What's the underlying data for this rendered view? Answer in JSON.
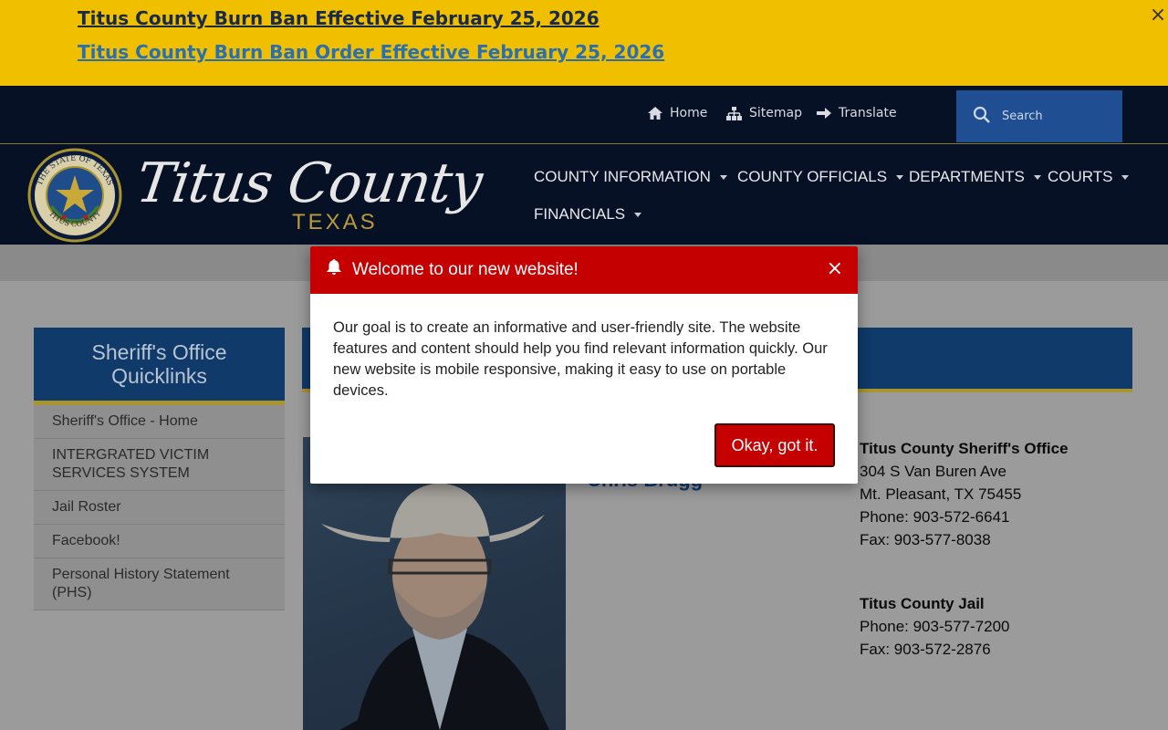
{
  "alerts": {
    "items": [
      "Titus County Burn Ban Effective February 25, 2026",
      "Titus County Burn Ban Order Effective February 25, 2026"
    ],
    "close_glyph": "×"
  },
  "utility_nav": {
    "home": "Home",
    "sitemap": "Sitemap",
    "translate": "Translate",
    "search_placeholder": "Search"
  },
  "brand": {
    "name": "Titus County",
    "sub": "TEXAS",
    "seal_top_text": "THE STATE OF TEXAS",
    "seal_bottom_text": "TITUS COUNTY",
    "accent": "#a8952e",
    "navy": "#071126"
  },
  "main_nav": [
    "COUNTY INFORMATION",
    "COUNTY OFFICIALS",
    "DEPARTMENTS",
    "COURTS",
    "FINANCIALS"
  ],
  "quicklinks": {
    "title": "Sheriff's Office Quicklinks",
    "items": [
      "Sheriff's Office - Home",
      "INTERGRATED VICTIM SERVICES SYSTEM",
      "Jail Roster",
      "Facebook!",
      "Personal History Statement (PHS)"
    ]
  },
  "sheriff": {
    "name_partial": "Chris Brugg"
  },
  "contacts": {
    "office": {
      "title": "Titus County Sheriff's Office",
      "address1": "304 S Van Buren Ave",
      "address2": "Mt. Pleasant, TX 75455",
      "phone": "Phone: 903-572-6641",
      "fax": "Fax: 903-577-8038"
    },
    "jail": {
      "title": "Titus County Jail",
      "phone": "Phone: 903-577-7200",
      "fax": "Fax: 903-572-2876"
    }
  },
  "modal": {
    "title": "Welcome to our new website!",
    "close_glyph": "×",
    "body": "Our goal is to create an informative and user-friendly site. The website features and content should help you find relevant information quickly. Our new website is mobile responsive, making it easy to use on portable devices.",
    "button": "Okay, got it.",
    "color": "#c40000"
  }
}
